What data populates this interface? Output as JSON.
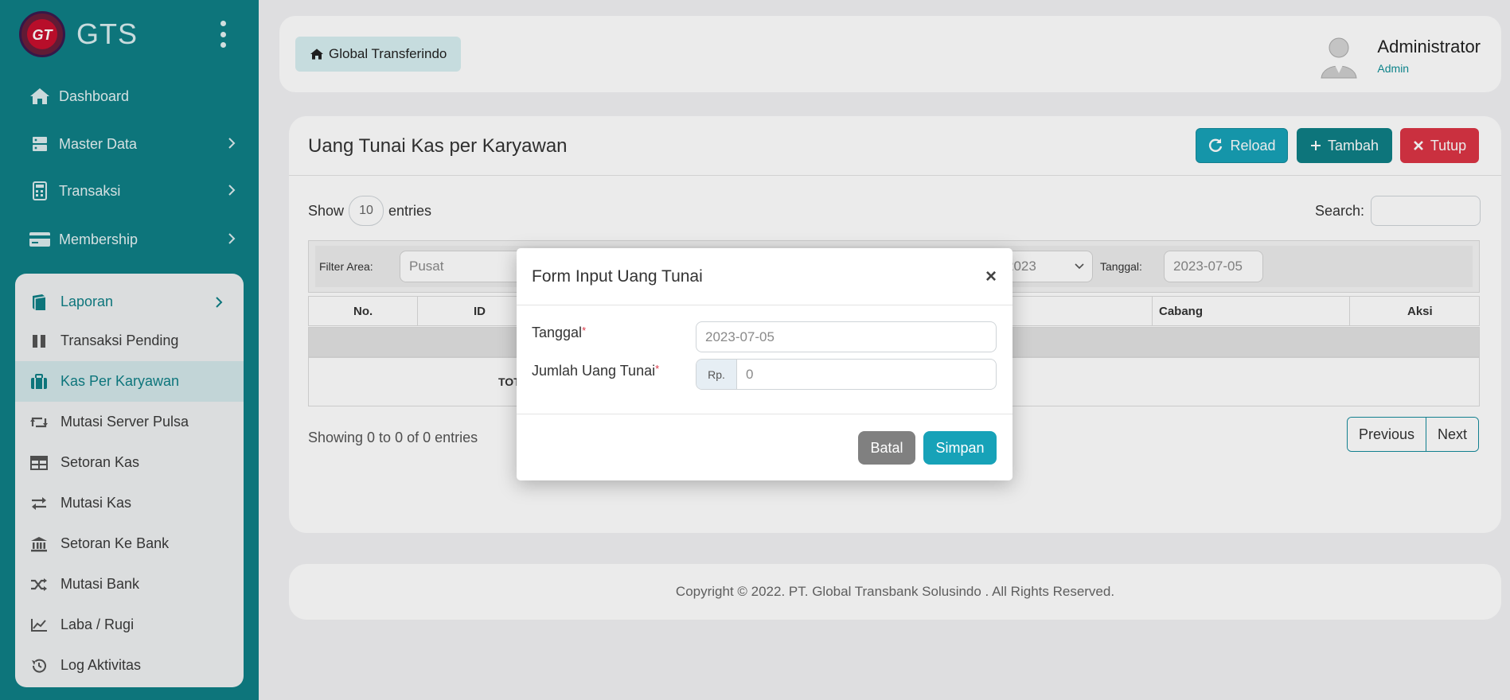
{
  "app": {
    "name": "GTS"
  },
  "colors": {
    "primary": "#0f7f86",
    "info": "#17a2b8",
    "danger": "#dc3545"
  },
  "sidebar": {
    "items": [
      {
        "label": "Dashboard",
        "icon": "home-icon"
      },
      {
        "label": "Master Data",
        "icon": "server-icon"
      },
      {
        "label": "Transaksi",
        "icon": "calculator-icon"
      },
      {
        "label": "Membership",
        "icon": "credit-card-icon"
      }
    ],
    "report_menu": {
      "label": "Laporan",
      "items": [
        {
          "label": "Transaksi Pending",
          "icon": "pause-icon"
        },
        {
          "label": "Kas Per Karyawan",
          "icon": "briefcase-icon",
          "active": true
        },
        {
          "label": "Mutasi Server Pulsa",
          "icon": "retweet-icon"
        },
        {
          "label": "Setoran Kas",
          "icon": "table-icon"
        },
        {
          "label": "Mutasi Kas",
          "icon": "exchange-icon"
        },
        {
          "label": "Setoran Ke Bank",
          "icon": "bank-icon"
        },
        {
          "label": "Mutasi Bank",
          "icon": "random-icon"
        },
        {
          "label": "Laba / Rugi",
          "icon": "line-chart-icon"
        },
        {
          "label": "Log Aktivitas",
          "icon": "history-icon"
        }
      ]
    }
  },
  "header": {
    "breadcrumb": "Global Transferindo",
    "user": {
      "name": "Administrator",
      "role": "Admin"
    }
  },
  "card": {
    "title": "Uang Tunai Kas per Karyawan",
    "buttons": {
      "reload": "Reload",
      "add": "Tambah",
      "close": "Tutup"
    },
    "show_label": "Show",
    "entries_value": "10",
    "entries_label": "entries",
    "search_label": "Search:",
    "filter": {
      "area_label": "Filter Area:",
      "area_value": "Pusat",
      "year_value": "2023",
      "date_label": "Tanggal:",
      "date_value": "2023-07-05"
    },
    "table": {
      "columns": [
        "No.",
        "ID",
        "Cabang",
        "Aksi"
      ],
      "total_label": "TOT"
    },
    "info": "Showing 0 to 0 of 0 entries",
    "pager": {
      "prev": "Previous",
      "next": "Next"
    }
  },
  "footer": {
    "text": "Copyright © 2022. PT. Global Transbank Solusindo . All Rights Reserved."
  },
  "modal": {
    "title": "Form Input Uang Tunai",
    "close": "×",
    "date_label": "Tanggal",
    "date_value": "2023-07-05",
    "amount_label": "Jumlah Uang Tunai",
    "currency_prefix": "Rp.",
    "amount_placeholder": "0",
    "required_mark": "*",
    "cancel": "Batal",
    "save": "Simpan"
  }
}
